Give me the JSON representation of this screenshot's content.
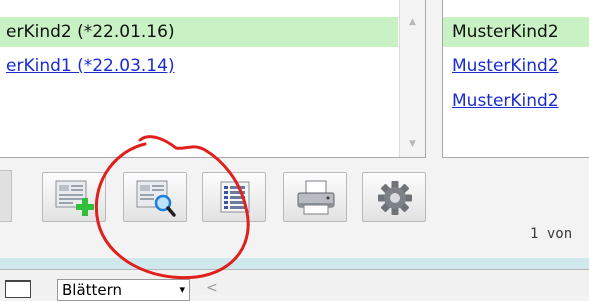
{
  "left_list": {
    "rows": [
      {
        "label": "erKind2 (*22.01.16)",
        "selected": true
      },
      {
        "label": "erKind1 (*22.03.14)",
        "selected": false
      }
    ]
  },
  "right_list": {
    "rows": [
      {
        "label": "MusterKind2"
      },
      {
        "label": "MusterKind2"
      },
      {
        "label": "MusterKind2"
      }
    ]
  },
  "scrollbar": {
    "up_arrow": "▲",
    "down_arrow": "▼"
  },
  "toolbar": {
    "buttons": [
      {
        "name": "add-record-button",
        "icon": "document-plus-icon"
      },
      {
        "name": "search-record-button",
        "icon": "document-magnifier-icon"
      },
      {
        "name": "list-view-button",
        "icon": "list-icon"
      },
      {
        "name": "print-button",
        "icon": "printer-icon"
      },
      {
        "name": "settings-button",
        "icon": "gear-icon"
      }
    ]
  },
  "pagination": {
    "text": "1 von"
  },
  "bottom_bar": {
    "select_value": "Blättern",
    "caret": "▾",
    "scroll_left": "<"
  },
  "colors": {
    "selected_row": "#c8f2c4",
    "link": "#1a2cd0",
    "annotation": "#e0201c",
    "plus": "#2fbf3a",
    "magnifier": "#1d7fd8"
  }
}
